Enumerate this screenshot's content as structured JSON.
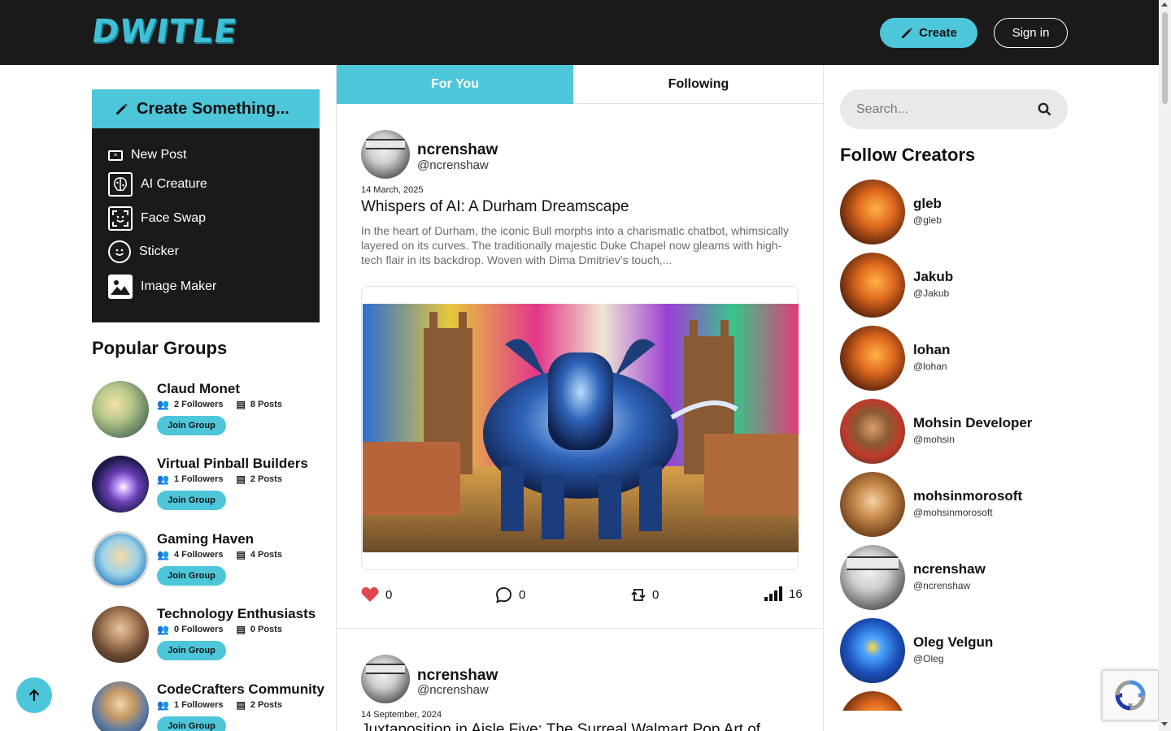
{
  "header": {
    "logo": "DWITLE",
    "create_label": "Create",
    "signin_label": "Sign in"
  },
  "colors": {
    "accent": "#4ec6da",
    "dark": "#1a1a1a",
    "like": "#e0464f"
  },
  "create_menu": {
    "title": "Create Something...",
    "items": [
      {
        "label": "New Post",
        "icon": "newspaper-icon"
      },
      {
        "label": "AI Creature",
        "icon": "brain-icon"
      },
      {
        "label": "Face Swap",
        "icon": "face-scan-icon"
      },
      {
        "label": "Sticker",
        "icon": "smiley-icon"
      },
      {
        "label": "Image Maker",
        "icon": "image-icon"
      }
    ]
  },
  "groups": {
    "title": "Popular Groups",
    "join_label": "Join Group",
    "items": [
      {
        "name": "Claud Monet",
        "followers": "2 Followers",
        "posts": "8 Posts"
      },
      {
        "name": "Virtual Pinball Builders",
        "followers": "1 Followers",
        "posts": "2 Posts"
      },
      {
        "name": "Gaming Haven",
        "followers": "4 Followers",
        "posts": "4 Posts"
      },
      {
        "name": "Technology Enthusiasts",
        "followers": "0 Followers",
        "posts": "0 Posts"
      },
      {
        "name": "CodeCrafters Community",
        "followers": "1 Followers",
        "posts": "2 Posts"
      }
    ]
  },
  "feed": {
    "tabs": [
      {
        "label": "For You",
        "active": true
      },
      {
        "label": "Following",
        "active": false
      }
    ],
    "posts": [
      {
        "author": "ncrenshaw",
        "handle": "@ncrenshaw",
        "date": "14 March, 2025",
        "title": "Whispers of AI: A Durham Dreamscape",
        "excerpt": "In the heart of Durham, the iconic Bull morphs into a charismatic chatbot, whimsically layered on its curves. The traditionally majestic Duke Chapel now gleams with high-tech flair in its backdrop. Woven with Dima Dmitriev’s touch,...",
        "likes": "0",
        "comments": "0",
        "reposts": "0",
        "views": "16"
      },
      {
        "author": "ncrenshaw",
        "handle": "@ncrenshaw",
        "date": "14 September, 2024",
        "title": "Juxtaposition in Aisle Five: The Surreal Walmart Pop Art of..."
      }
    ]
  },
  "search": {
    "placeholder": "Search..."
  },
  "creators": {
    "title": "Follow Creators",
    "items": [
      {
        "name": "gleb",
        "handle": "@gleb"
      },
      {
        "name": "Jakub",
        "handle": "@Jakub"
      },
      {
        "name": "lohan",
        "handle": "@lohan"
      },
      {
        "name": "Mohsin Developer",
        "handle": "@mohsin"
      },
      {
        "name": "mohsinmorosoft",
        "handle": "@mohsinmorosoft"
      },
      {
        "name": "ncrenshaw",
        "handle": "@ncrenshaw"
      },
      {
        "name": "Oleg Velgun",
        "handle": "@Oleg"
      }
    ]
  }
}
